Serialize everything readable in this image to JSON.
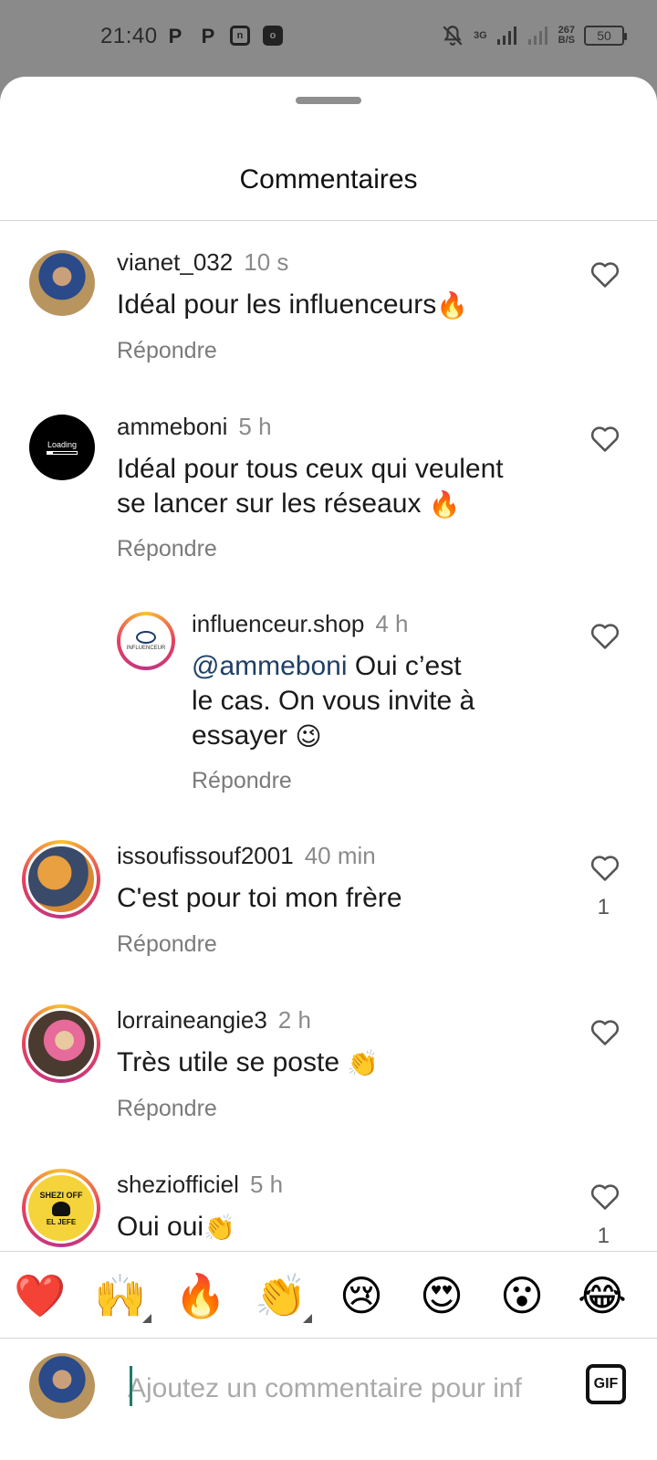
{
  "status": {
    "time": "21:40",
    "net_label": "3G",
    "speed": "267",
    "speed_unit": "B/S",
    "battery": "50"
  },
  "sheet": {
    "title": "Commentaires"
  },
  "comments": [
    {
      "username": "vianet_032",
      "time": "10 s",
      "text": "Idéal pour les influenceurs",
      "emoji": "🔥",
      "reply": "Répondre",
      "likes": ""
    },
    {
      "username": "ammeboni",
      "time": "5 h",
      "text_line1": "Idéal pour tous ceux qui veulent",
      "text_line2": "se lancer sur les réseaux",
      "emoji": "🔥",
      "reply": "Répondre",
      "avatar_label": "Loading",
      "likes": ""
    },
    {
      "username": "influenceur.shop",
      "time": "4 h",
      "mention": "@ammeboni",
      "text_line1": " Oui c’est",
      "text_line2": "le cas. On vous invite à",
      "text_line3": "essayer",
      "emoji": "😉",
      "reply": "Répondre",
      "avatar_label": "INFLUENCEUR",
      "likes": ""
    },
    {
      "username": "issoufissouf2001",
      "time": "40 min",
      "text": "C'est pour toi mon frère",
      "reply": "Répondre",
      "likes": "1"
    },
    {
      "username": "lorraineangie3",
      "time": "2 h",
      "text": "Très utile se poste",
      "emoji": "👏",
      "reply": "Répondre",
      "likes": ""
    },
    {
      "username": "sheziofficiel",
      "time": "5 h",
      "text": "Oui oui",
      "emoji": "👏",
      "avatar_label_1": "SHEZI OFF",
      "avatar_label_2": "EL JEFE",
      "likes": "1"
    }
  ],
  "emoji_bar": [
    "❤️",
    "🙌",
    "🔥",
    "👏",
    "😢",
    "😍",
    "😮",
    "😂"
  ],
  "input": {
    "placeholder": "Ajoutez un commentaire pour inf",
    "gif_label": "GIF"
  },
  "colors": {
    "accent_ring": "#e4405f",
    "mention": "#1f3f66"
  }
}
